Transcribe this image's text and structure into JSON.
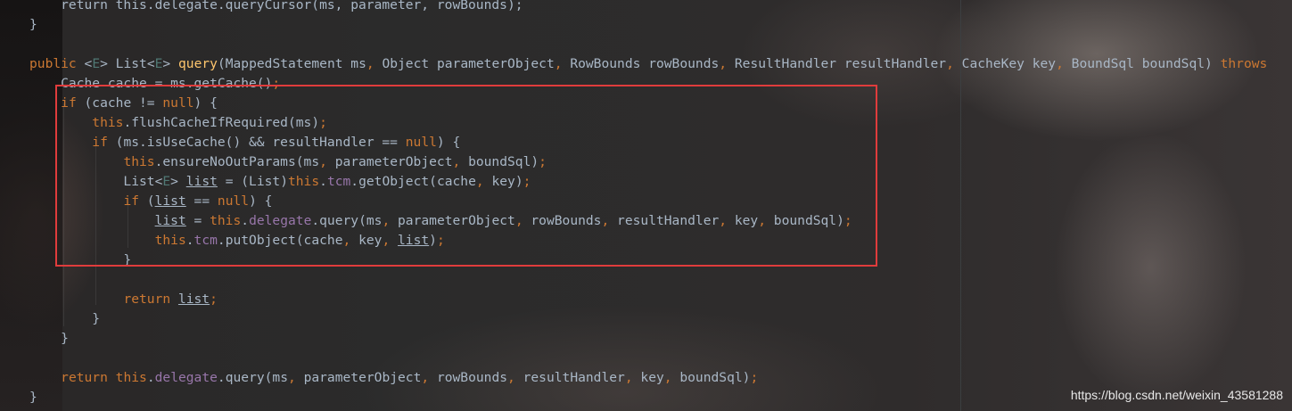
{
  "editor": {
    "theme_colors": {
      "background": "#2b2b2b",
      "keyword": "#cc7832",
      "method": "#ffc66d",
      "field": "#9876aa",
      "type_param": "#507874",
      "plain": "#a9b7c6",
      "highlight_box": "#e03c3c"
    },
    "lines": [
      [
        {
          "t": "    return this.delegate.queryCursor(ms, parameter, rowBounds);",
          "c": "pl"
        }
      ],
      [
        {
          "t": "}",
          "c": "pl"
        }
      ],
      [],
      [
        {
          "t": "public ",
          "c": "kw"
        },
        {
          "t": "<",
          "c": "pl"
        },
        {
          "t": "E",
          "c": "tp"
        },
        {
          "t": "> List<",
          "c": "pl"
        },
        {
          "t": "E",
          "c": "tp"
        },
        {
          "t": "> ",
          "c": "pl"
        },
        {
          "t": "query",
          "c": "fn"
        },
        {
          "t": "(MappedStatement ms",
          "c": "pl"
        },
        {
          "t": ", ",
          "c": "kw"
        },
        {
          "t": "Object parameterObject",
          "c": "pl"
        },
        {
          "t": ", ",
          "c": "kw"
        },
        {
          "t": "RowBounds rowBounds",
          "c": "pl"
        },
        {
          "t": ", ",
          "c": "kw"
        },
        {
          "t": "ResultHandler resultHandler",
          "c": "pl"
        },
        {
          "t": ", ",
          "c": "kw"
        },
        {
          "t": "CacheKey key",
          "c": "pl"
        },
        {
          "t": ", ",
          "c": "kw"
        },
        {
          "t": "BoundSql boundSql) ",
          "c": "pl"
        },
        {
          "t": "throws",
          "c": "kw"
        }
      ],
      [
        {
          "t": "    Cache cache = ms.getCache()",
          "c": "pl"
        },
        {
          "t": ";",
          "c": "kw"
        }
      ],
      [
        {
          "t": "    ",
          "c": "pl"
        },
        {
          "t": "if ",
          "c": "kw"
        },
        {
          "t": "(cache != ",
          "c": "pl"
        },
        {
          "t": "null",
          "c": "kw"
        },
        {
          "t": ") {",
          "c": "pl"
        }
      ],
      [
        {
          "t": "        ",
          "c": "pl"
        },
        {
          "t": "this",
          "c": "kw"
        },
        {
          "t": ".flushCacheIfRequired(ms)",
          "c": "pl"
        },
        {
          "t": ";",
          "c": "kw"
        }
      ],
      [
        {
          "t": "        ",
          "c": "pl"
        },
        {
          "t": "if ",
          "c": "kw"
        },
        {
          "t": "(ms.isUseCache() && resultHandler == ",
          "c": "pl"
        },
        {
          "t": "null",
          "c": "kw"
        },
        {
          "t": ") {",
          "c": "pl"
        }
      ],
      [
        {
          "t": "            ",
          "c": "pl"
        },
        {
          "t": "this",
          "c": "kw"
        },
        {
          "t": ".ensureNoOutParams(ms",
          "c": "pl"
        },
        {
          "t": ", ",
          "c": "kw"
        },
        {
          "t": "parameterObject",
          "c": "pl"
        },
        {
          "t": ", ",
          "c": "kw"
        },
        {
          "t": "boundSql)",
          "c": "pl"
        },
        {
          "t": ";",
          "c": "kw"
        }
      ],
      [
        {
          "t": "            List<",
          "c": "pl"
        },
        {
          "t": "E",
          "c": "tp"
        },
        {
          "t": "> ",
          "c": "pl"
        },
        {
          "t": "list",
          "c": "pl",
          "u": true
        },
        {
          "t": " = (List)",
          "c": "pl"
        },
        {
          "t": "this",
          "c": "kw"
        },
        {
          "t": ".",
          "c": "pl"
        },
        {
          "t": "tcm",
          "c": "fld"
        },
        {
          "t": ".getObject(cache",
          "c": "pl"
        },
        {
          "t": ", ",
          "c": "kw"
        },
        {
          "t": "key)",
          "c": "pl"
        },
        {
          "t": ";",
          "c": "kw"
        }
      ],
      [
        {
          "t": "            ",
          "c": "pl"
        },
        {
          "t": "if ",
          "c": "kw"
        },
        {
          "t": "(",
          "c": "pl"
        },
        {
          "t": "list",
          "c": "pl",
          "u": true
        },
        {
          "t": " == ",
          "c": "pl"
        },
        {
          "t": "null",
          "c": "kw"
        },
        {
          "t": ") {",
          "c": "pl"
        }
      ],
      [
        {
          "t": "                ",
          "c": "pl"
        },
        {
          "t": "list",
          "c": "pl",
          "u": true
        },
        {
          "t": " = ",
          "c": "pl"
        },
        {
          "t": "this",
          "c": "kw"
        },
        {
          "t": ".",
          "c": "pl"
        },
        {
          "t": "delegate",
          "c": "fld"
        },
        {
          "t": ".query(ms",
          "c": "pl"
        },
        {
          "t": ", ",
          "c": "kw"
        },
        {
          "t": "parameterObject",
          "c": "pl"
        },
        {
          "t": ", ",
          "c": "kw"
        },
        {
          "t": "rowBounds",
          "c": "pl"
        },
        {
          "t": ", ",
          "c": "kw"
        },
        {
          "t": "resultHandler",
          "c": "pl"
        },
        {
          "t": ", ",
          "c": "kw"
        },
        {
          "t": "key",
          "c": "pl"
        },
        {
          "t": ", ",
          "c": "kw"
        },
        {
          "t": "boundSql)",
          "c": "pl"
        },
        {
          "t": ";",
          "c": "kw"
        }
      ],
      [
        {
          "t": "                ",
          "c": "pl"
        },
        {
          "t": "this",
          "c": "kw"
        },
        {
          "t": ".",
          "c": "pl"
        },
        {
          "t": "tcm",
          "c": "fld"
        },
        {
          "t": ".putObject(cache",
          "c": "pl"
        },
        {
          "t": ", ",
          "c": "kw"
        },
        {
          "t": "key",
          "c": "pl"
        },
        {
          "t": ", ",
          "c": "kw"
        },
        {
          "t": "list",
          "c": "pl",
          "u": true
        },
        {
          "t": ")",
          "c": "pl"
        },
        {
          "t": ";",
          "c": "kw"
        }
      ],
      [
        {
          "t": "            }",
          "c": "pl"
        }
      ],
      [],
      [
        {
          "t": "            ",
          "c": "pl"
        },
        {
          "t": "return ",
          "c": "kw"
        },
        {
          "t": "list",
          "c": "pl",
          "u": true
        },
        {
          "t": ";",
          "c": "kw"
        }
      ],
      [
        {
          "t": "        }",
          "c": "pl"
        }
      ],
      [
        {
          "t": "    }",
          "c": "pl"
        }
      ],
      [],
      [
        {
          "t": "    ",
          "c": "pl"
        },
        {
          "t": "return ",
          "c": "kw"
        },
        {
          "t": "this",
          "c": "kw"
        },
        {
          "t": ".",
          "c": "pl"
        },
        {
          "t": "delegate",
          "c": "fld"
        },
        {
          "t": ".query(ms",
          "c": "pl"
        },
        {
          "t": ", ",
          "c": "kw"
        },
        {
          "t": "parameterObject",
          "c": "pl"
        },
        {
          "t": ", ",
          "c": "kw"
        },
        {
          "t": "rowBounds",
          "c": "pl"
        },
        {
          "t": ", ",
          "c": "kw"
        },
        {
          "t": "resultHandler",
          "c": "pl"
        },
        {
          "t": ", ",
          "c": "kw"
        },
        {
          "t": "key",
          "c": "pl"
        },
        {
          "t": ", ",
          "c": "kw"
        },
        {
          "t": "boundSql)",
          "c": "pl"
        },
        {
          "t": ";",
          "c": "kw"
        }
      ],
      [
        {
          "t": "}",
          "c": "pl"
        }
      ]
    ]
  },
  "watermark": "https://blog.csdn.net/weixin_43581288"
}
